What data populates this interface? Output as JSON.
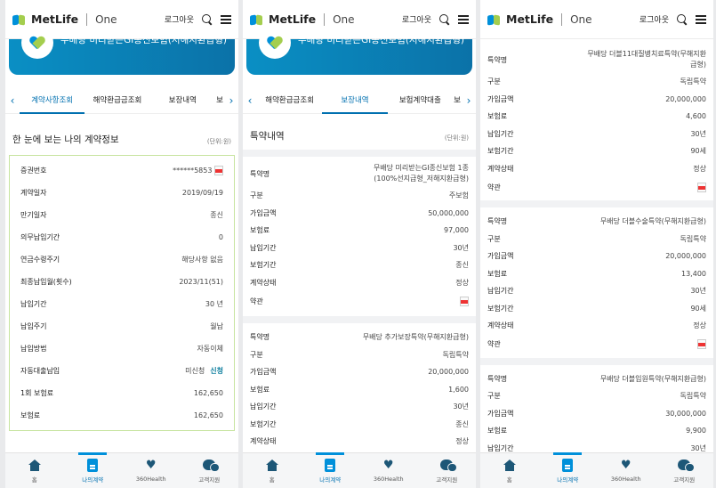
{
  "header": {
    "brand": "MetLife",
    "brand_sub": "One",
    "logout": "로그아웃"
  },
  "banner": {
    "title": "무배당 미리받는GI종신보험(저해지환급형)"
  },
  "panel1": {
    "tabs": [
      "계약사항조회",
      "해약환급금조회",
      "보장내역",
      "보"
    ],
    "section_title": "한 눈에 보는 나의 계약정보",
    "unit": "(단위:원)",
    "rows": [
      {
        "k": "증권번호",
        "v": "******5853",
        "pdf": true
      },
      {
        "k": "계약일자",
        "v": "2019/09/19"
      },
      {
        "k": "만기일자",
        "v": "종신"
      },
      {
        "k": "의무납입기간",
        "v": "0"
      },
      {
        "k": "연금수령주기",
        "v": "해당사항 없음"
      },
      {
        "k": "최종납입월(횟수)",
        "v": "2023/11(51)"
      },
      {
        "k": "납입기간",
        "v": "30 년"
      },
      {
        "k": "납입주기",
        "v": "월납"
      },
      {
        "k": "납입방법",
        "v": "자동이체"
      },
      {
        "k": "자동대출납입",
        "v": "미신청",
        "link": "신청"
      },
      {
        "k": "1회 보험료",
        "v": "162,650"
      },
      {
        "k": "보험료",
        "v": "162,650"
      }
    ]
  },
  "panel2": {
    "tabs": [
      "해약환급금조회",
      "보장내역",
      "보험계약대출",
      "보"
    ],
    "section_title": "특약내역",
    "unit": "(단위:원)",
    "blocks": [
      {
        "rows": [
          {
            "k": "특약명",
            "v": "무배당 미리받는GI종신보험 1종 (100%선지급형_저해지환급형)"
          },
          {
            "k": "구분",
            "v": "주보험"
          },
          {
            "k": "가입금액",
            "v": "50,000,000"
          },
          {
            "k": "보험료",
            "v": "97,000"
          },
          {
            "k": "납입기간",
            "v": "30년"
          },
          {
            "k": "보험기간",
            "v": "종신"
          },
          {
            "k": "계약상태",
            "v": "정상"
          },
          {
            "k": "약관",
            "v": "",
            "pdf": true
          }
        ]
      },
      {
        "rows": [
          {
            "k": "특약명",
            "v": "무배당 추가보장특약(무해지환급형)"
          },
          {
            "k": "구분",
            "v": "독립특약"
          },
          {
            "k": "가입금액",
            "v": "20,000,000"
          },
          {
            "k": "보험료",
            "v": "1,600"
          },
          {
            "k": "납입기간",
            "v": "30년"
          },
          {
            "k": "보험기간",
            "v": "종신"
          },
          {
            "k": "계약상태",
            "v": "정상"
          }
        ]
      }
    ]
  },
  "panel3": {
    "blocks": [
      {
        "rows": [
          {
            "k": "특약명",
            "v": "무배당 더블11대질병치료특약(무해지환급형)"
          },
          {
            "k": "구분",
            "v": "독립특약"
          },
          {
            "k": "가입금액",
            "v": "20,000,000"
          },
          {
            "k": "보험료",
            "v": "4,600"
          },
          {
            "k": "납입기간",
            "v": "30년"
          },
          {
            "k": "보험기간",
            "v": "90세"
          },
          {
            "k": "계약상태",
            "v": "정상"
          },
          {
            "k": "약관",
            "v": "",
            "pdf": true
          }
        ]
      },
      {
        "rows": [
          {
            "k": "특약명",
            "v": "무배당 더블수술특약(무해지환급형)"
          },
          {
            "k": "구분",
            "v": "독립특약"
          },
          {
            "k": "가입금액",
            "v": "20,000,000"
          },
          {
            "k": "보험료",
            "v": "13,400"
          },
          {
            "k": "납입기간",
            "v": "30년"
          },
          {
            "k": "보험기간",
            "v": "90세"
          },
          {
            "k": "계약상태",
            "v": "정상"
          },
          {
            "k": "약관",
            "v": "",
            "pdf": true
          }
        ]
      },
      {
        "rows": [
          {
            "k": "특약명",
            "v": "무배당 더블입원특약(무해지환급형)"
          },
          {
            "k": "구분",
            "v": "독립특약"
          },
          {
            "k": "가입금액",
            "v": "30,000,000"
          },
          {
            "k": "보험료",
            "v": "9,900"
          },
          {
            "k": "납입기간",
            "v": "30년"
          }
        ]
      }
    ]
  },
  "bottom_nav": [
    {
      "label": "홈",
      "icon": "home-icon"
    },
    {
      "label": "나의계약",
      "icon": "contract-icon",
      "active": true
    },
    {
      "label": "360Health",
      "icon": "health-icon"
    },
    {
      "label": "고객지원",
      "icon": "support-icon"
    }
  ],
  "colors": {
    "accent": "#0090da",
    "brand_green": "#a4ce4e",
    "banner": "#0b7fb6"
  }
}
